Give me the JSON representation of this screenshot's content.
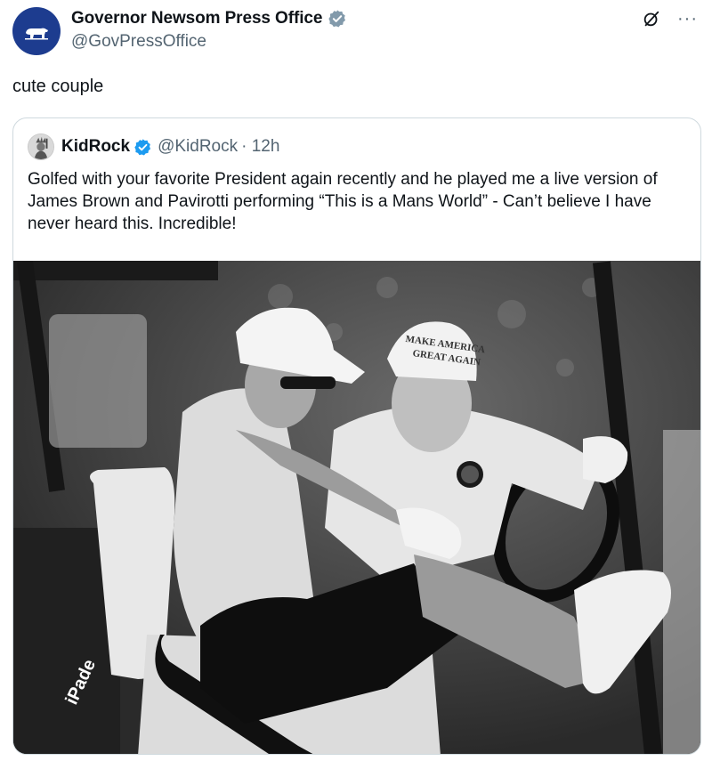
{
  "author": {
    "display_name": "Governor Newsom Press Office",
    "handle": "@GovPressOffice",
    "badge": "gray-verified-icon",
    "avatar": "california-bear-avatar"
  },
  "tweet": {
    "text": "cute couple"
  },
  "actions": {
    "grok_icon": "grok-icon",
    "more": "···"
  },
  "quoted": {
    "display_name": "KidRock",
    "handle": "@KidRock",
    "time": "· 12h",
    "badge": "blue-verified-icon",
    "text": "Golfed with your favorite President again recently and he played me a live version of James Brown and Pavirotti performing “This is a Mans World” - Can’t believe I have never heard this. Incredible!",
    "photo": {
      "hat_text": "MAKE AMERICA GREAT AGAIN",
      "cart_text": "iPade"
    }
  },
  "colors": {
    "avatar_bg": "#1d3c8f",
    "gray_badge": "#829aab",
    "blue_badge": "#1d9bf0",
    "secondary_text": "#536471",
    "border": "#cfd9de"
  }
}
